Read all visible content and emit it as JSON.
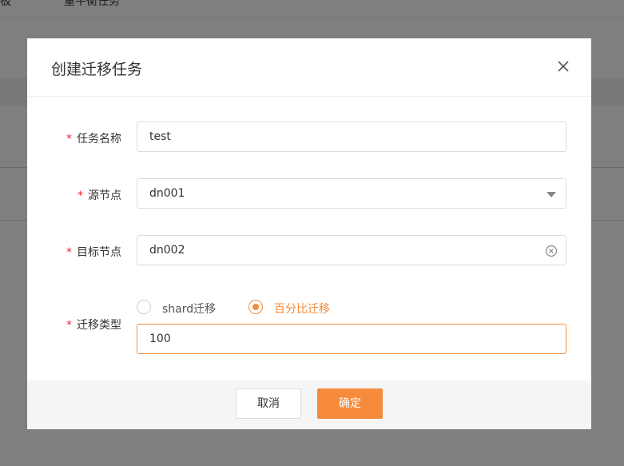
{
  "background": {
    "tabs": [
      "面板",
      "重平衡任务"
    ]
  },
  "dialog": {
    "title": "创建迁移任务",
    "close_icon": "close-icon",
    "fields": {
      "task_name": {
        "label": "任务名称",
        "value": "test"
      },
      "source_node": {
        "label": "源节点",
        "value": "dn001"
      },
      "target_node": {
        "label": "目标节点",
        "value": "dn002"
      },
      "migration_type": {
        "label": "迁移类型",
        "options": [
          "shard迁移",
          "百分比迁移"
        ],
        "selected": "百分比迁移",
        "value": "100"
      }
    },
    "required_mark": "*",
    "buttons": {
      "cancel": "取消",
      "ok": "确定"
    }
  },
  "colors": {
    "accent": "#f58b3b",
    "required": "#f5222d",
    "overlay": "rgba(0,0,0,0.5)"
  }
}
